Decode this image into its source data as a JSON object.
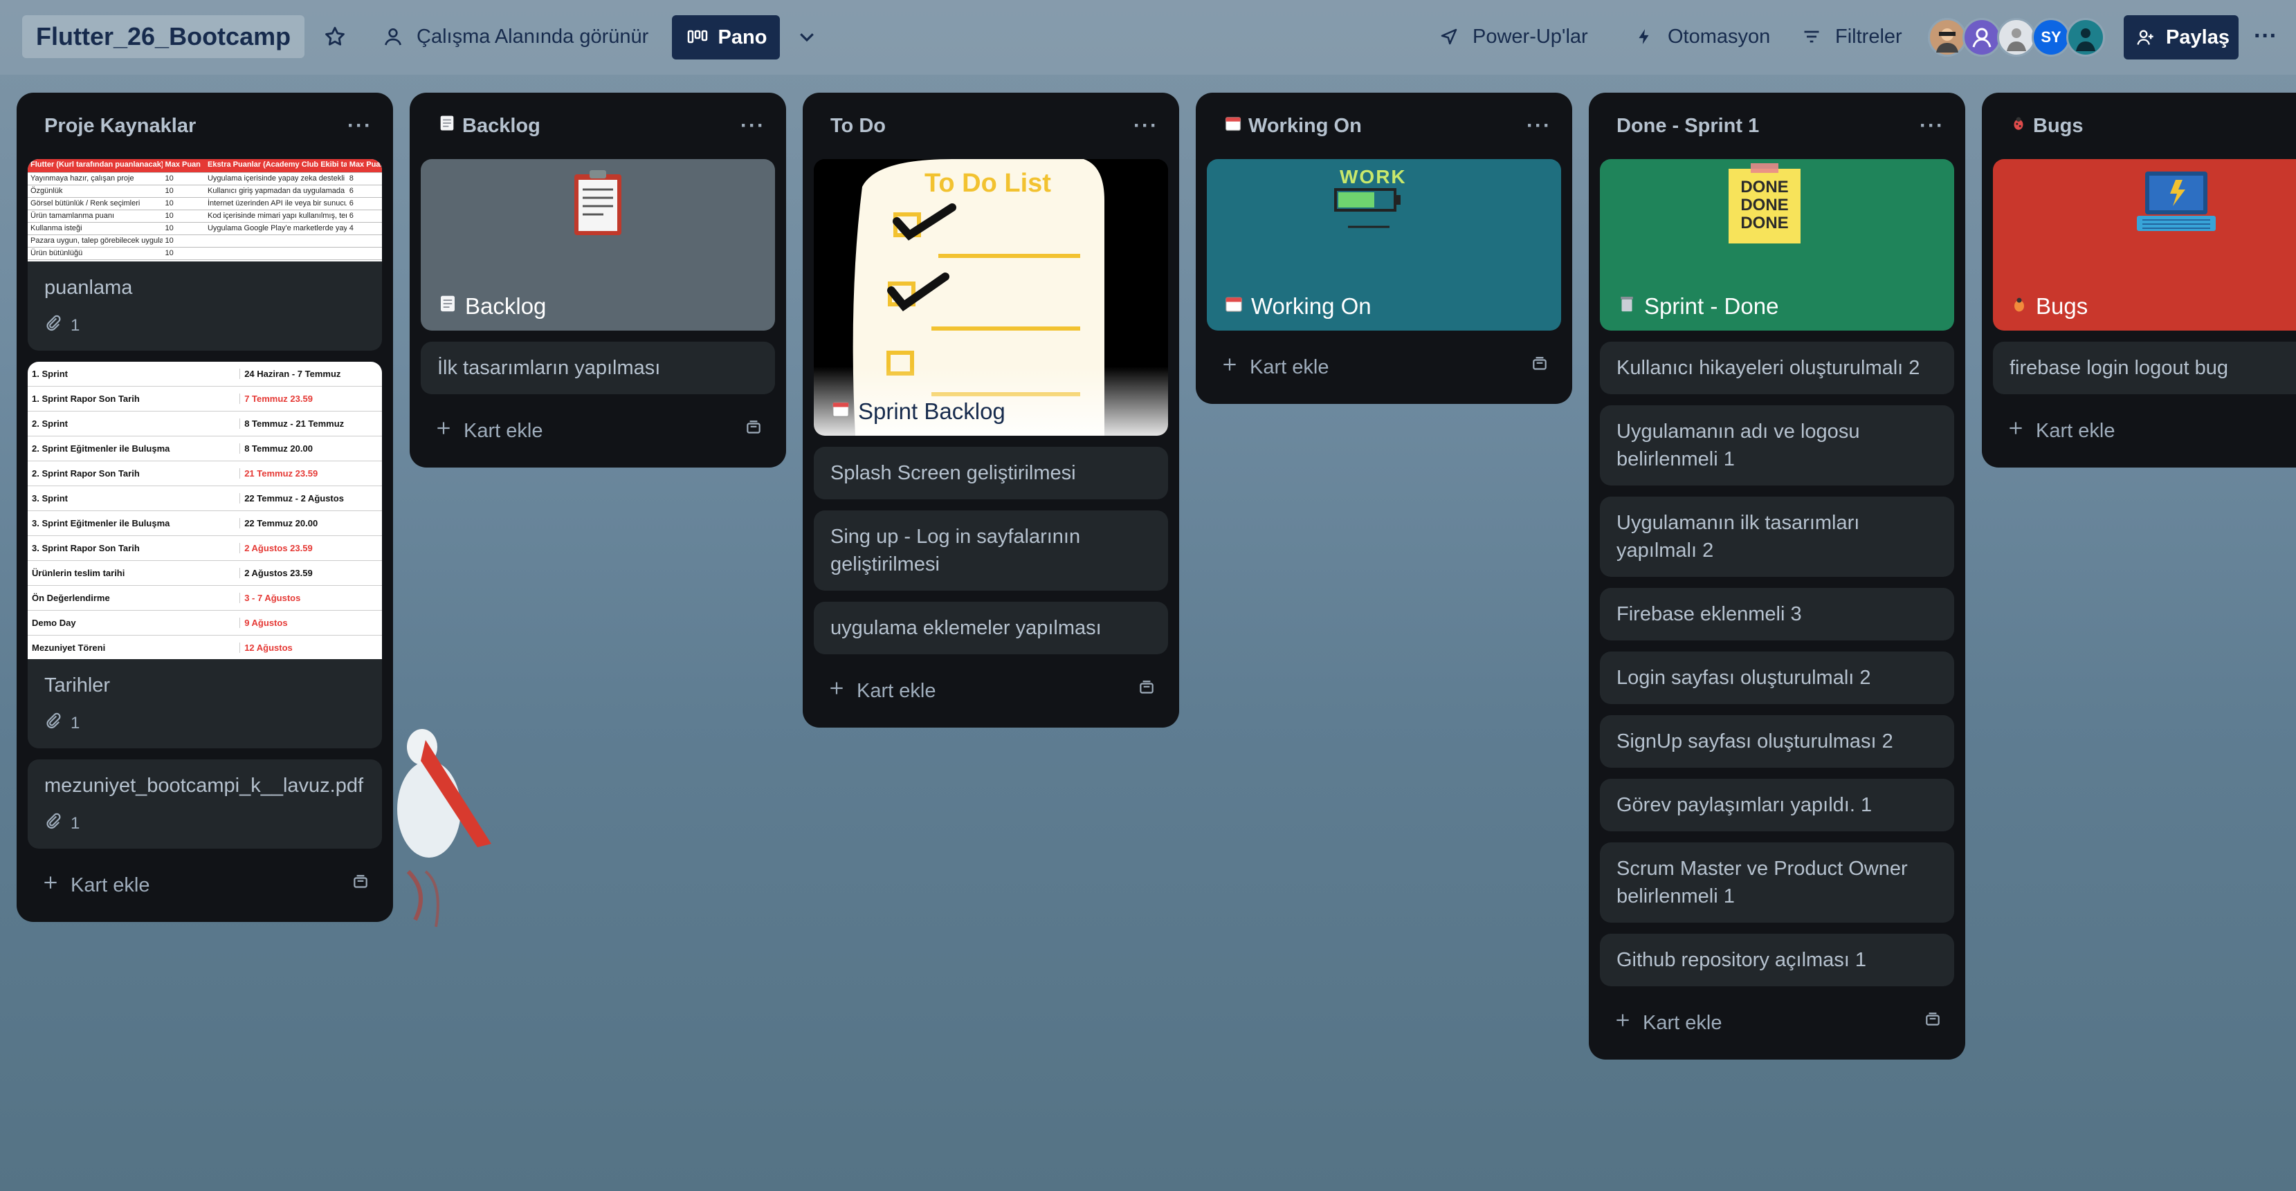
{
  "header": {
    "board_title": "Flutter_26_Bootcamp",
    "visibility_label": "Çalışma Alanında görünür",
    "view_label": "Pano",
    "powerups_label": "Power-Up'lar",
    "automation_label": "Otomasyon",
    "filters_label": "Filtreler",
    "avatar_initials": "SY",
    "share_label": "Paylaş",
    "more_label": "···"
  },
  "lists": [
    {
      "title": "Proje Kaynaklar",
      "menu": "···",
      "cards": [
        {
          "title": "puanlama",
          "attachments": "1"
        },
        {
          "title": "Tarihler",
          "attachments": "1"
        },
        {
          "title": "mezuniyet_bootcampi_k__lavuz.pdf",
          "attachments": "1"
        }
      ],
      "add_label": "Kart ekle"
    },
    {
      "title": "Backlog",
      "menu": "···",
      "cover_label": "Backlog",
      "cards": [
        {
          "title": "İlk tasarımların yapılması"
        }
      ],
      "add_label": "Kart ekle"
    },
    {
      "title": "To Do",
      "menu": "···",
      "cover_image_text": "To Do List",
      "cover_label": "Sprint Backlog",
      "cards": [
        {
          "title": "Splash Screen geliştirilmesi"
        },
        {
          "title": "Sing up - Log in sayfalarının geliştirilmesi"
        },
        {
          "title": "uygulama eklemeler yapılması"
        }
      ],
      "add_label": "Kart ekle"
    },
    {
      "title": "Working On",
      "menu": "···",
      "cover_label": "Working On",
      "cover_image_text": "WORK",
      "add_label": "Kart ekle"
    },
    {
      "title": "Done - Sprint 1",
      "menu": "···",
      "cover_label": "Sprint - Done",
      "cover_image_text": "DONE",
      "cards": [
        {
          "title": "Kullanıcı hikayeleri oluşturulmalı 2"
        },
        {
          "title": "Uygulamanın adı ve logosu belirlenmeli 1"
        },
        {
          "title": "Uygulamanın ilk tasarımları yapılmalı 2"
        },
        {
          "title": "Firebase eklenmeli 3"
        },
        {
          "title": "Login sayfası oluşturulmalı 2"
        },
        {
          "title": "SignUp sayfası oluşturulması 2"
        },
        {
          "title": "Görev paylaşımları yapıldı. 1"
        },
        {
          "title": "Scrum Master ve Product Owner belirlenmeli 1"
        },
        {
          "title": "Github repository açılması 1"
        }
      ],
      "add_label": "Kart ekle"
    },
    {
      "title": "Bugs",
      "menu": "···",
      "cover_label": "Bugs",
      "cards": [
        {
          "title": "firebase login logout bug"
        }
      ],
      "add_label": "Kart ekle"
    }
  ],
  "sheet_puanlama": {
    "headers": [
      "Flutter (Kurl tarafından puanlanacak)",
      "Max Puan",
      "Ekstra Puanlar (Academy Club Ekibi tarafından kitlenacak)",
      "Max Puan"
    ],
    "rows": [
      [
        "Yayınmaya hazır, çalışan proje",
        "10",
        "Uygulama içerisinde yapay zeka destekli modüller bulunuyor",
        "8"
      ],
      [
        "Özgünlük",
        "10",
        "Kullanıcı giriş yapmadan da uygulamada bazı özellikleri kullanabiliyor",
        "6"
      ],
      [
        "Görsel bütünlük / Renk seçimleri",
        "10",
        "İnternet üzerinden API ile veya bir sunucu ile etkileşime geçiyor",
        "6"
      ],
      [
        "Ürün tamamlanma puanı",
        "10",
        "Kod içerisinde mimari yapı kullanılmış, temiz kod prensipleri mevcut",
        "6"
      ],
      [
        "Kullanma isteği",
        "10",
        "Uygulama Google Play'e marketlerde yayınlanmaya hazır",
        "4"
      ],
      [
        "Pazara uygun, talep görebilecek uygulama",
        "10",
        "",
        ""
      ],
      [
        "Ürün bütünlüğü",
        "10",
        "",
        ""
      ]
    ]
  },
  "sheet_tarihler": {
    "rows": [
      [
        "1. Sprint",
        "24 Haziran - 7 Temmuz",
        false
      ],
      [
        "1. Sprint Rapor Son Tarih",
        "7 Temmuz 23.59",
        true
      ],
      [
        "2. Sprint",
        "8 Temmuz - 21 Temmuz",
        false
      ],
      [
        "2. Sprint Eğitmenler ile Buluşma",
        "8 Temmuz 20.00",
        false
      ],
      [
        "2. Sprint Rapor Son Tarih",
        "21 Temmuz 23.59",
        true
      ],
      [
        "3. Sprint",
        "22 Temmuz - 2 Ağustos",
        false
      ],
      [
        "3. Sprint Eğitmenler ile Buluşma",
        "22 Temmuz 20.00",
        false
      ],
      [
        "3. Sprint Rapor Son Tarih",
        "2 Ağustos 23.59",
        true
      ],
      [
        "Ürünlerin teslim tarihi",
        "2 Ağustos 23.59",
        false
      ],
      [
        "Ön Değerlendirme",
        "3 - 7 Ağustos",
        true
      ],
      [
        "Demo Day",
        "9 Ağustos",
        true
      ],
      [
        "Mezuniyet Töreni",
        "12 Ağustos",
        true
      ]
    ]
  },
  "colors": {
    "list_bg": "#111317",
    "card_bg": "#22272b",
    "text": "#b6c2cf",
    "working_cover": "#1f6f7f",
    "done_cover": "#1f845a",
    "bugs_cover": "#c9372c",
    "backlog_cover": "#5b6770",
    "nav_dark": "#172b4d"
  }
}
